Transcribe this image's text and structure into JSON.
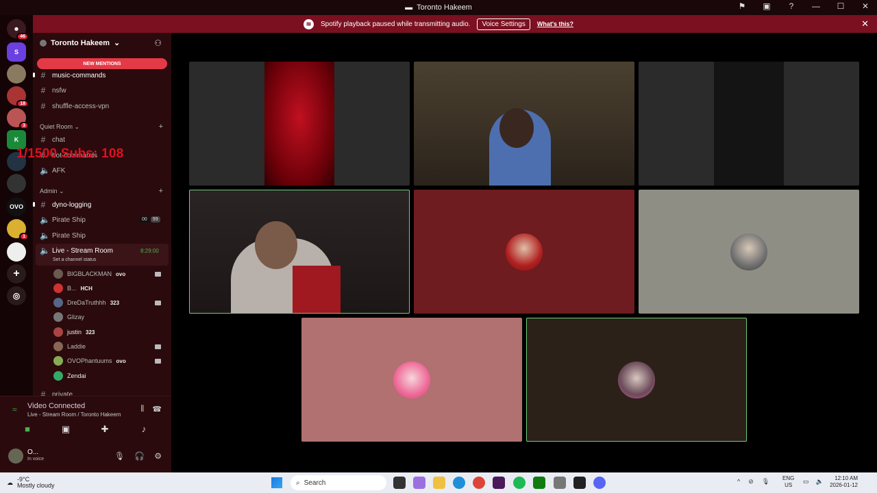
{
  "window": {
    "title": "Toronto Hakeem"
  },
  "notice": {
    "text": "Spotify playback paused while transmitting audio.",
    "voice_settings_label": "Voice Settings",
    "whats_this_label": "What's this?"
  },
  "rail": {
    "top_badge": "46",
    "badges": [
      "18",
      "3",
      "1"
    ]
  },
  "sidebar": {
    "server_name": "Toronto Hakeem",
    "new_mentions_label": "NEW MENTIONS",
    "channels_top": [
      "music-commands",
      "nsfw",
      "shuffle-access-vpn"
    ],
    "category_quiet": "Quiet Room",
    "channels_quiet": [
      "chat",
      "bot-commands",
      "AFK"
    ],
    "category_admin": "Admin",
    "channels_admin": [
      "dyno-logging",
      "Pirate Ship",
      "Pirate Ship"
    ],
    "pirate_counts": {
      "a": "00",
      "b": "99"
    },
    "live_room": {
      "name": "Live - Stream Room",
      "time": "8:29:00",
      "status": "Set a channel status"
    },
    "voice_users": [
      {
        "name": "BIGBLACKMAN",
        "tag": "ovo"
      },
      {
        "name": "B...",
        "tag": "HCH"
      },
      {
        "name": "DreDaTruthhh",
        "tag": "323"
      },
      {
        "name": "Glizay",
        "tag": ""
      },
      {
        "name": "justin",
        "tag": "323"
      },
      {
        "name": "Laddie",
        "tag": ""
      },
      {
        "name": "OVOPhantuums",
        "tag": "ovo"
      },
      {
        "name": "Zendai",
        "tag": ""
      }
    ],
    "cut_channel": "private",
    "overlay_text": "1/1500 Subs: 108"
  },
  "voice_panel": {
    "title": "Video Connected",
    "subtitle": "Live - Stream Room / Toronto Hakeem",
    "user_name": "O...",
    "user_status": "In voice"
  },
  "taskbar": {
    "temperature": "-9°C",
    "weather": "Mostly cloudy",
    "search_placeholder": "Search",
    "lang_top": "ENG",
    "lang_bottom": "US",
    "time": "12:10 AM",
    "date": "2026-01-12"
  },
  "colors": {
    "accent_red": "#7a1020",
    "sidebar_bg": "#2a0a0d",
    "speaking_green": "#6ecf7e"
  }
}
